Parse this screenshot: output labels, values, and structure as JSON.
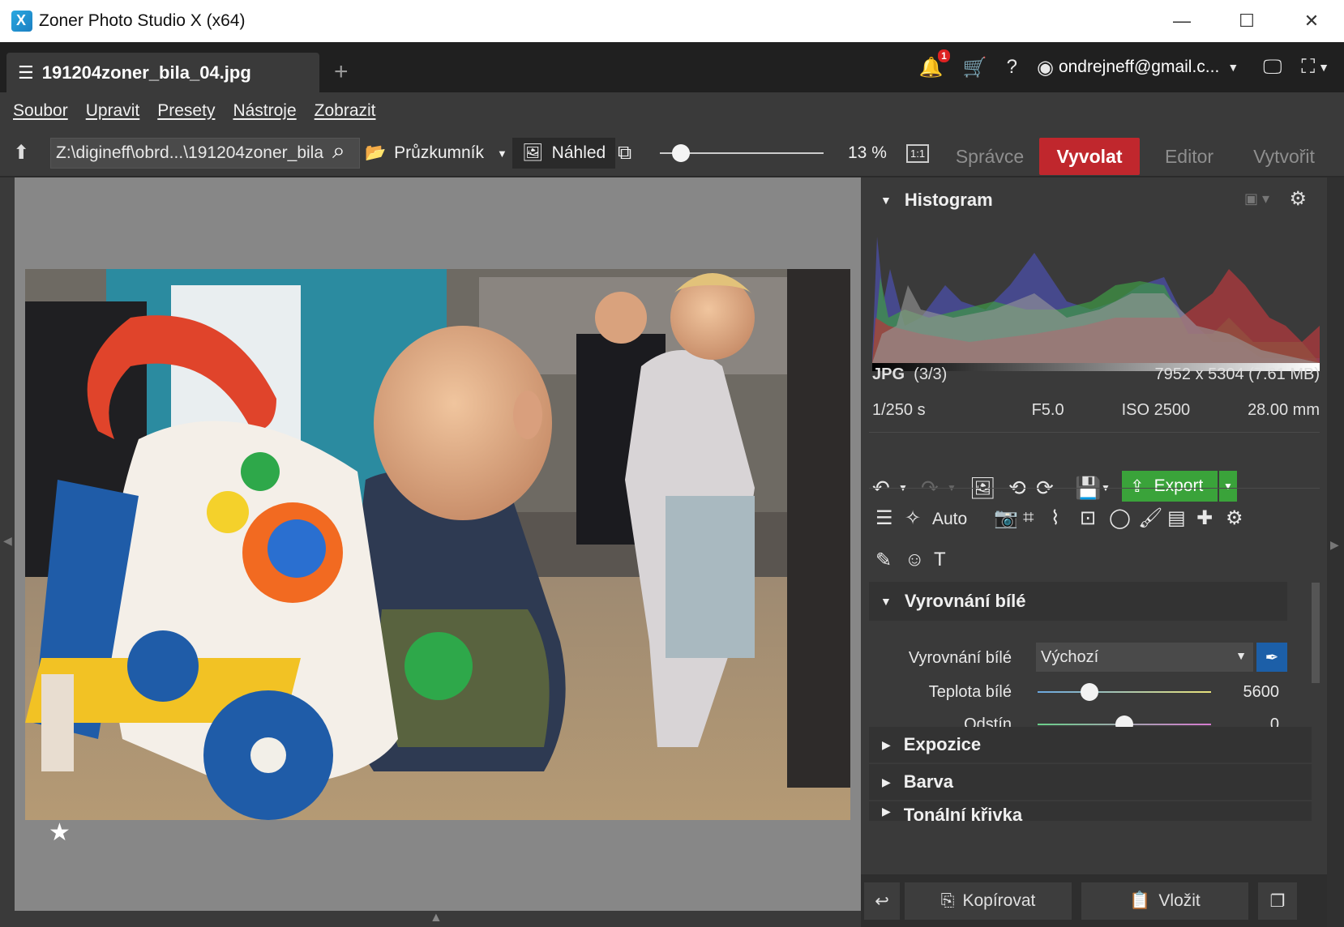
{
  "window": {
    "title": "Zoner Photo Studio X (x64)",
    "minimize": "—",
    "maximize": "☐",
    "close": "✕"
  },
  "tab": {
    "filename": "191204zoner_bila_04.jpg",
    "add": "+"
  },
  "topbar": {
    "notifications_count": "1",
    "help": "?",
    "user_email": "ondrejneff@gmail.c..."
  },
  "menu": {
    "items": [
      "Soubor",
      "Upravit",
      "Presety",
      "Nástroje",
      "Zobrazit"
    ]
  },
  "toolbar": {
    "path": "Z:\\digineff\\obrd...\\191204zoner_bila",
    "browser_label": "Průzkumník",
    "preview_label": "Náhled",
    "zoom": "13 %",
    "zoom_level": 0.13,
    "one_to_one": "1:1",
    "modes": [
      "Správce",
      "Vyvolat",
      "Editor",
      "Vytvořit"
    ],
    "active_mode": "Vyvolat"
  },
  "histogram": {
    "title": "Histogram",
    "format": "JPG",
    "count": "(3/3)",
    "dimensions": "7952 x 5304 (7.61 MB)",
    "shutter": "1/250 s",
    "aperture": "F5.0",
    "iso": "ISO 2500",
    "focal": "28.00 mm"
  },
  "actions": {
    "export_label": "Export"
  },
  "tools": {
    "auto_label": "Auto"
  },
  "white_balance": {
    "title": "Vyrovnání bílé",
    "wb_label": "Vyrovnání bílé",
    "wb_value": "Výchozí",
    "temp_label": "Teplota bílé",
    "temp_value": "5600",
    "temp_level": 0.3,
    "tint_label": "Odstín",
    "tint_value": "0",
    "tint_level": 0.5
  },
  "sections": [
    "Expozice",
    "Barva",
    "Tonální křivka"
  ],
  "bottom": {
    "copy_label": "Kopírovat",
    "paste_label": "Vložit"
  },
  "rating": "★",
  "colors": {
    "accent": "#c0272d",
    "export": "#3aa33a",
    "eyedropper": "#1c5fa8"
  }
}
